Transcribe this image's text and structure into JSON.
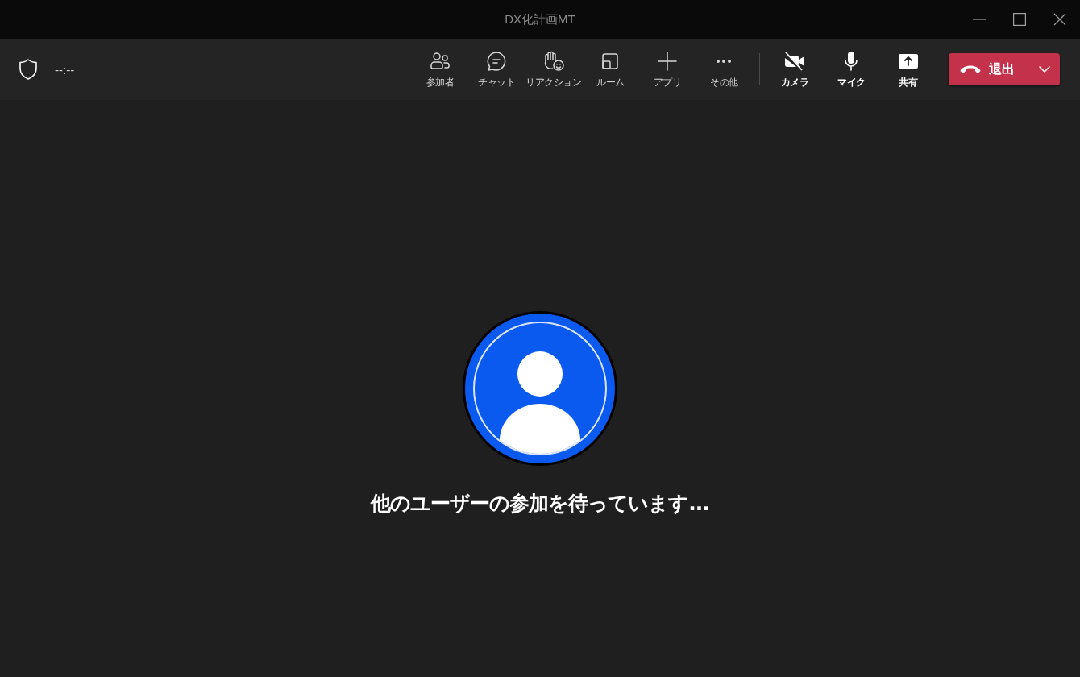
{
  "window": {
    "title": "DX化計画MT"
  },
  "toolbar": {
    "timer": "--:--",
    "buttons": [
      {
        "kind": "people",
        "label": "参加者"
      },
      {
        "kind": "chat",
        "label": "チャット"
      },
      {
        "kind": "reaction",
        "label": "リアクション"
      },
      {
        "kind": "room",
        "label": "ルーム"
      },
      {
        "kind": "apps",
        "label": "アプリ"
      },
      {
        "kind": "more",
        "label": "その他"
      }
    ],
    "devices": [
      {
        "kind": "camera",
        "label": "カメラ",
        "on": false
      },
      {
        "kind": "mic",
        "label": "マイク",
        "on": true
      },
      {
        "kind": "share",
        "label": "共有",
        "on": false
      }
    ],
    "leave": {
      "label": "退出"
    }
  },
  "stage": {
    "message": "他のユーザーの参加を待っています..."
  }
}
